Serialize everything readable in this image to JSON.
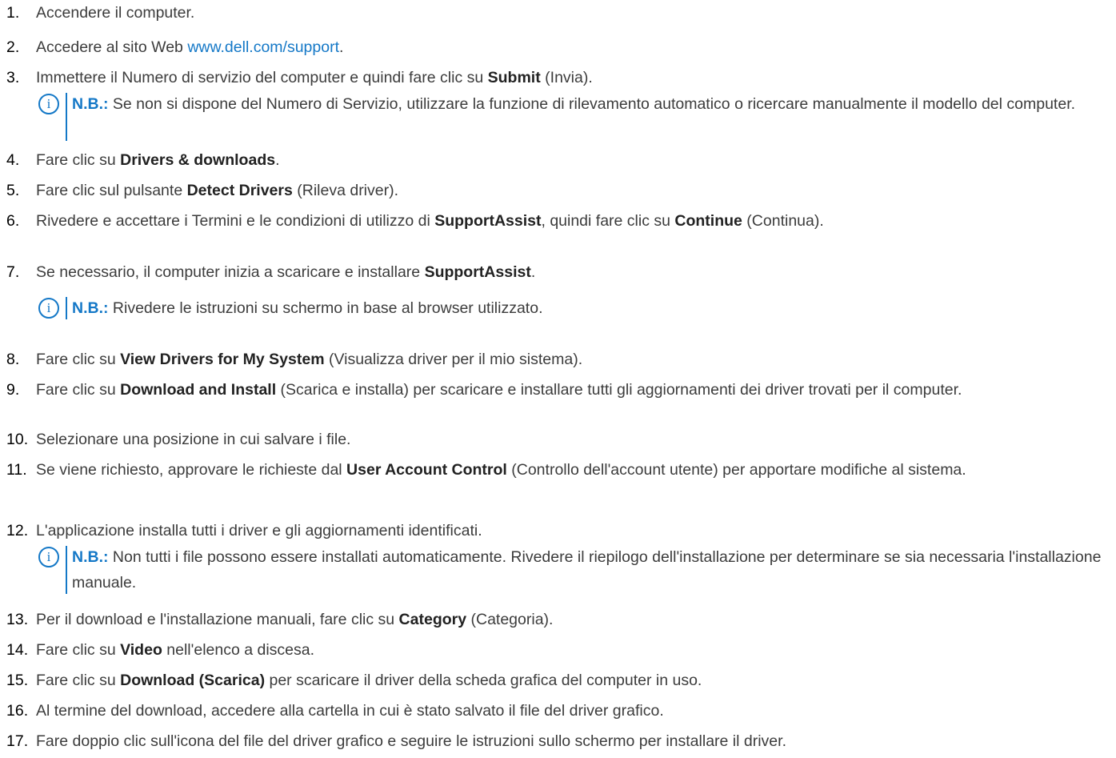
{
  "steps": [
    {
      "num": "1.",
      "segments": [
        {
          "t": "Accendere il computer."
        }
      ]
    },
    {
      "num": "2.",
      "segments": [
        {
          "t": "Accedere al sito Web "
        },
        {
          "t": "www.dell.com/support",
          "link": true
        },
        {
          "t": "."
        }
      ]
    },
    {
      "num": "3.",
      "segments": [
        {
          "t": "Immettere il Numero di servizio del computer e quindi fare clic su "
        },
        {
          "t": "Submit",
          "b": true
        },
        {
          "t": " (Invia)."
        }
      ]
    },
    {
      "num": "4.",
      "segments": [
        {
          "t": "Fare clic su "
        },
        {
          "t": "Drivers & downloads",
          "b": true
        },
        {
          "t": "."
        }
      ]
    },
    {
      "num": "5.",
      "segments": [
        {
          "t": "Fare clic sul pulsante "
        },
        {
          "t": "Detect Drivers",
          "b": true
        },
        {
          "t": " (Rileva driver)."
        }
      ]
    },
    {
      "num": "6.",
      "segments": [
        {
          "t": "Rivedere e accettare i Termini e le condizioni di utilizzo di "
        },
        {
          "t": "SupportAssist",
          "b": true
        },
        {
          "t": ", quindi fare clic su "
        },
        {
          "t": "Continue",
          "b": true
        },
        {
          "t": " (Continua)."
        }
      ]
    },
    {
      "num": "7.",
      "segments": [
        {
          "t": "Se necessario, il computer inizia a scaricare e installare "
        },
        {
          "t": "SupportAssist",
          "b": true
        },
        {
          "t": "."
        }
      ]
    },
    {
      "num": "8.",
      "segments": [
        {
          "t": "Fare clic su "
        },
        {
          "t": "View Drivers for My System",
          "b": true
        },
        {
          "t": " (Visualizza driver per il mio sistema)."
        }
      ]
    },
    {
      "num": "9.",
      "segments": [
        {
          "t": "Fare clic su "
        },
        {
          "t": "Download and Install",
          "b": true
        },
        {
          "t": " (Scarica e installa) per scaricare e installare tutti gli aggiornamenti dei driver trovati per il computer."
        }
      ]
    },
    {
      "num": "10.",
      "segments": [
        {
          "t": "Selezionare una posizione in cui salvare i file."
        }
      ]
    },
    {
      "num": "11.",
      "segments": [
        {
          "t": "Se viene richiesto, approvare le richieste dal "
        },
        {
          "t": "User Account Control",
          "b": true
        },
        {
          "t": " (Controllo dell'account utente) per apportare modifiche al sistema."
        }
      ]
    },
    {
      "num": "12.",
      "segments": [
        {
          "t": "L'applicazione installa tutti i driver e gli aggiornamenti identificati."
        }
      ]
    },
    {
      "num": "13.",
      "segments": [
        {
          "t": "Per il download e l'installazione manuali, fare clic su "
        },
        {
          "t": "Category",
          "b": true
        },
        {
          "t": " (Categoria)."
        }
      ]
    },
    {
      "num": "14.",
      "segments": [
        {
          "t": "Fare clic su "
        },
        {
          "t": "Video",
          "b": true
        },
        {
          "t": " nell'elenco a discesa."
        }
      ]
    },
    {
      "num": "15.",
      "segments": [
        {
          "t": "Fare clic su "
        },
        {
          "t": "Download (Scarica)",
          "b": true
        },
        {
          "t": " per scaricare il driver della scheda grafica del computer in uso."
        }
      ]
    },
    {
      "num": "16.",
      "segments": [
        {
          "t": "Al termine del download, accedere alla cartella in cui è stato salvato il file del driver grafico."
        }
      ]
    },
    {
      "num": "17.",
      "segments": [
        {
          "t": "Fare doppio clic sull'icona del file del driver grafico e seguire le istruzioni sullo schermo per installare il driver."
        }
      ]
    }
  ],
  "notes": [
    {
      "label": "N.B.:",
      "text": " Se non si dispone del Numero di Servizio, utilizzare la funzione di rilevamento automatico o ricercare manualmente il modello del computer."
    },
    {
      "label": "N.B.:",
      "text": " Rivedere le istruzioni su schermo in base al browser utilizzato."
    },
    {
      "label": "N.B.:",
      "text": " Non tutti i file possono essere installati automaticamente. Rivedere il riepilogo dell'installazione per determinare se sia necessaria l'installazione manuale."
    }
  ],
  "note_icon_glyph": "i",
  "colors": {
    "link": "#1478c7",
    "note_accent": "#1478c7",
    "text": "#3c3c3c"
  }
}
